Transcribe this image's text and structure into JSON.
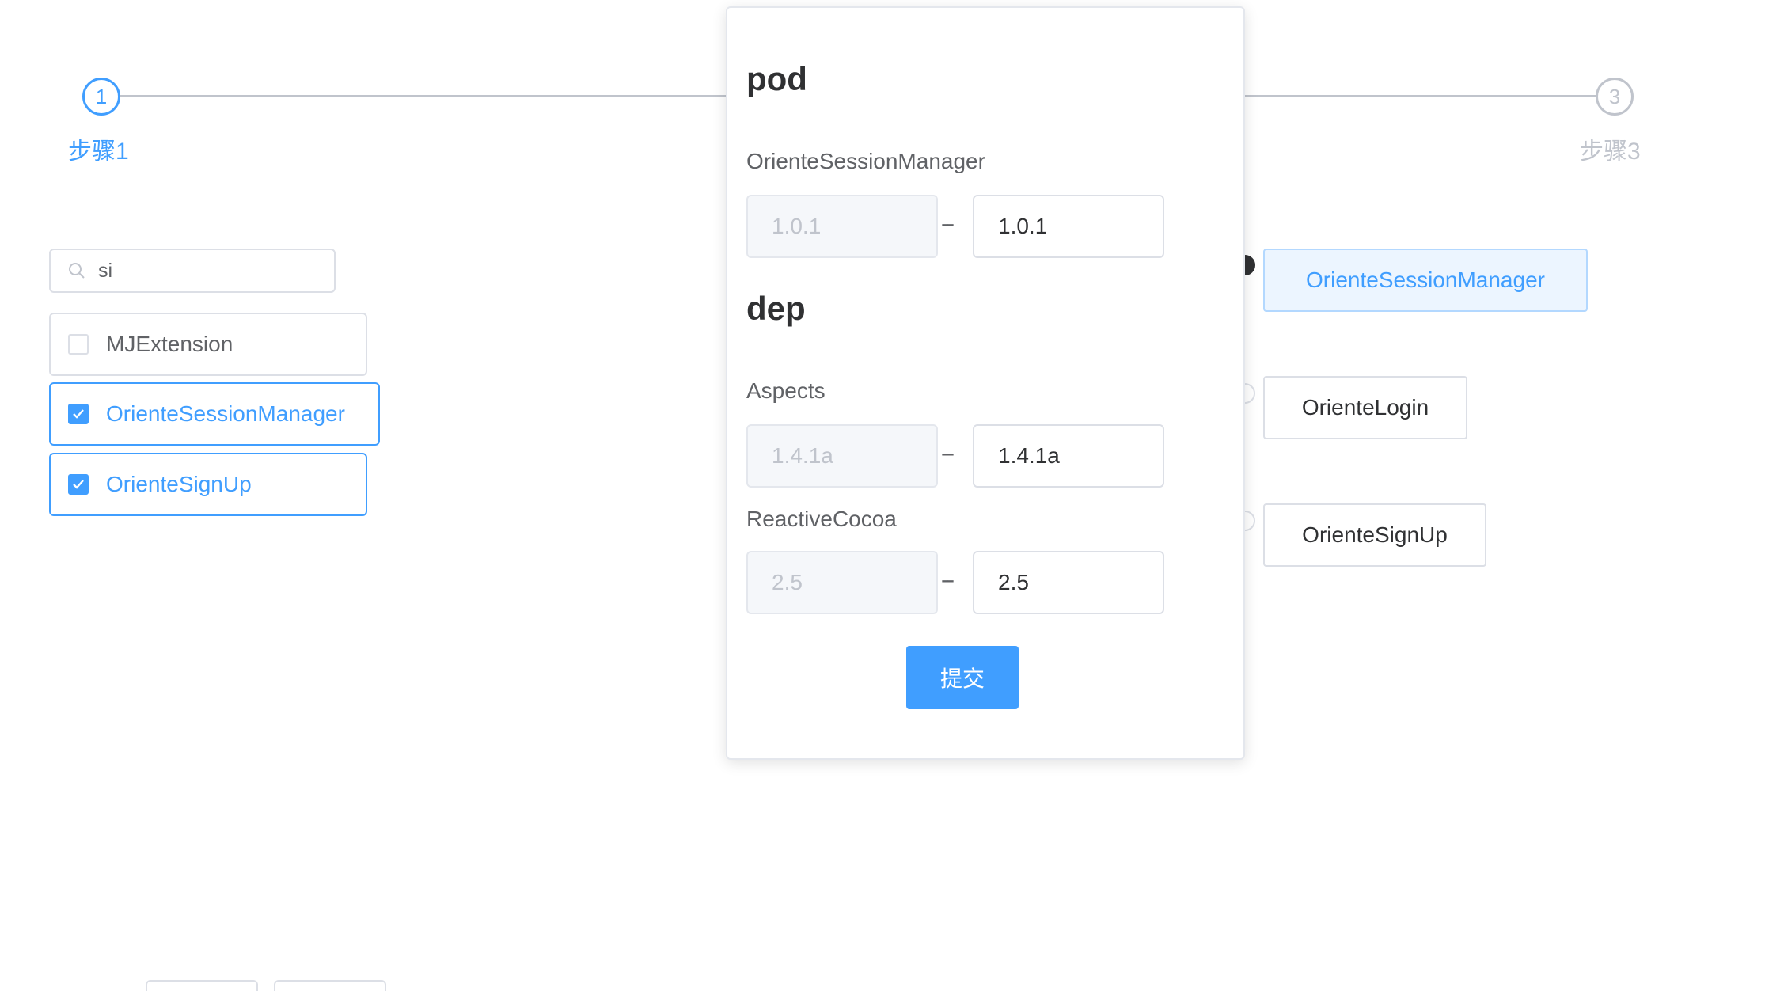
{
  "steps": [
    {
      "number": "1",
      "label": "步骤1",
      "state": "active"
    },
    {
      "number": "3",
      "label": "步骤3",
      "state": "pending"
    }
  ],
  "search": {
    "value": "si",
    "icon": "search-icon"
  },
  "left_list": [
    {
      "label": "MJExtension",
      "checked": false
    },
    {
      "label": "OrienteSessionManager",
      "checked": true
    },
    {
      "label": "OrienteSignUp",
      "checked": true
    }
  ],
  "right_list": [
    {
      "label": "OrienteSessionManager",
      "selected": true
    },
    {
      "label": "OrienteLogin",
      "selected": false
    },
    {
      "label": "OrienteSignUp",
      "selected": false
    }
  ],
  "popup": {
    "pod_title": "pod",
    "pod_items": [
      {
        "name": "OrienteSessionManager",
        "current": "1.0.1",
        "target": "1.0.1"
      }
    ],
    "dep_title": "dep",
    "dep_items": [
      {
        "name": "Aspects",
        "current": "1.4.1a",
        "target": "1.4.1a"
      },
      {
        "name": "ReactiveCocoa",
        "current": "2.5",
        "target": "2.5"
      }
    ],
    "separator": "--",
    "submit_label": "提交"
  },
  "colors": {
    "accent": "#409eff",
    "border": "#dcdfe6",
    "muted": "#c0c4cc"
  }
}
